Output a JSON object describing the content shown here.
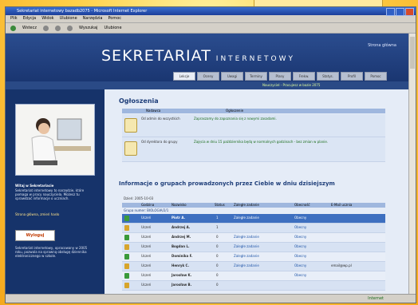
{
  "window": {
    "title": "Sekretariat internetowy bazadb2075 - Microsoft Internet Explorer"
  },
  "menu": [
    "Plik",
    "Edycja",
    "Widok",
    "Ulubione",
    "Narzędzia",
    "Pomoc"
  ],
  "toolbar": {
    "back": "Wstecz",
    "search": "Wyszukaj",
    "favorites": "Ulubione"
  },
  "site": {
    "title": "SEKRETARIAT",
    "subtitle": "INTERNETOWY",
    "login": "Strona główna"
  },
  "nav": [
    "Lekcje",
    "Oceny",
    "Uwagi",
    "Terminy",
    "Plany",
    "Frekw.",
    "Statys.",
    "Profil",
    "Pomoc"
  ],
  "status_info": "Nauczyciel - Pracujesz w bazie 2075",
  "left": {
    "heading": "Witaj w Sekretariacie",
    "text": "Sekretariat internetowy to narzędzie, które pomaga w pracy nauczyciela. Możesz tu sprawdzać informacje o uczniach.",
    "links": "Strona główna, zmień hasło",
    "button": "Wyloguj",
    "footer": "Sekretariat internetowy, opracowany w 2005 roku, pozwala na sprawną obsługę dziennika elektronicznego w szkole."
  },
  "announcements": {
    "title": "Ogłoszenia",
    "headers": [
      "Nadawca",
      "Ogłoszenie"
    ],
    "rows": [
      {
        "from": "Od admin do wszystkich",
        "text": "Zapraszamy do zapoznania się z nowymi zasadami."
      },
      {
        "from": "Od dyrektora do grupy",
        "text": "Zajęcia w dniu 15 października będą w normalnych godzinach - bez zmian w planie."
      }
    ]
  },
  "groups": {
    "title": "Informacje o grupach prowadzonych przez Ciebie w dniu dzisiejszym",
    "date": "Dzień: 2005-10-03",
    "headers": [
      "",
      "Godzina",
      "Nazwisko",
      "Status",
      "Zaległe zadanie",
      "Obecność",
      "E-Mail ucznia"
    ],
    "group_label": "Grupa numer: BIOLOGIA/2/1",
    "rows": [
      {
        "type": "Uczeń",
        "name": "Piotr A.",
        "status": "1",
        "task": "Zaległe zadanie",
        "presence": "Obecny",
        "email": ""
      },
      {
        "type": "Uczeń",
        "name": "Andrzej A.",
        "status": "1",
        "task": "",
        "presence": "Obecny",
        "email": ""
      },
      {
        "type": "Uczeń",
        "name": "Andrzej M.",
        "status": "0",
        "task": "Zaległe zadanie",
        "presence": "Obecny",
        "email": ""
      },
      {
        "type": "Uczeń",
        "name": "Bogdan L.",
        "status": "0",
        "task": "Zaległe zadanie",
        "presence": "Obecny",
        "email": ""
      },
      {
        "type": "Uczeń",
        "name": "Dominika F.",
        "status": "0",
        "task": "Zaległe zadanie",
        "presence": "Obecny",
        "email": ""
      },
      {
        "type": "Uczeń",
        "name": "Henryk C.",
        "status": "0",
        "task": "Zaległe zadanie",
        "presence": "Obecny",
        "email": "email@wp.pl"
      },
      {
        "type": "Uczeń",
        "name": "Jarosław K.",
        "status": "0",
        "task": "",
        "presence": "Obecny",
        "email": ""
      },
      {
        "type": "Uczeń",
        "name": "Jarosław B.",
        "status": "0",
        "task": "",
        "presence": "",
        "email": ""
      }
    ]
  },
  "statusbar": {
    "zone": "Internet"
  }
}
